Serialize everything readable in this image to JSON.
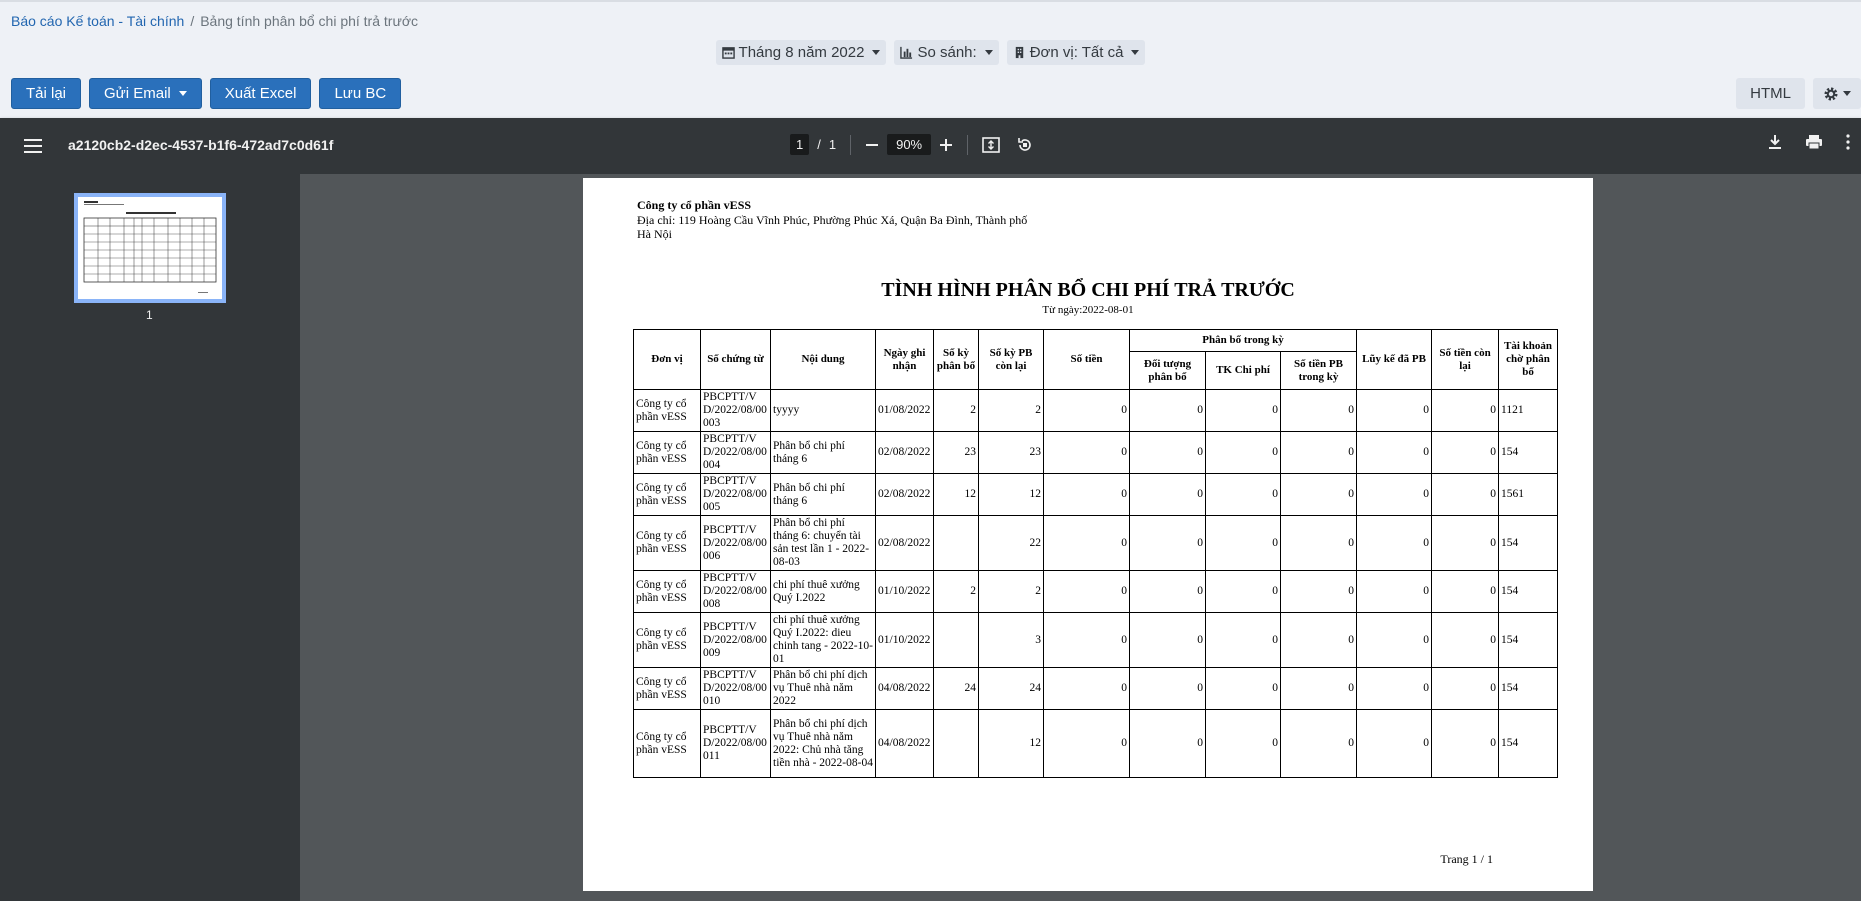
{
  "breadcrumb": {
    "root": "Báo cáo Kế toán - Tài chính",
    "current": "Bảng tính phân bổ chi phí trả trước"
  },
  "filters": {
    "period": "Tháng 8 năm 2022",
    "compare": "So sánh:",
    "unit": "Đơn vị: Tất cả"
  },
  "actions": {
    "reload": "Tải lại",
    "email": "Gửi Email",
    "excel": "Xuất Excel",
    "save": "Lưu BC",
    "html": "HTML"
  },
  "viewer": {
    "filename": "a2120cb2-d2ec-4537-b1f6-472ad7c0d61f",
    "page_current": "1",
    "page_sep": "/",
    "page_total": "1",
    "zoom": "90%",
    "thumb_label": "1"
  },
  "report": {
    "company": "Công ty cổ phần vESS",
    "address": "Địa chỉ: 119 Hoàng Cầu Vĩnh Phúc, Phường Phúc Xá, Quận Ba Đình, Thành phố Hà Nội",
    "title": "TÌNH HÌNH PHÂN BỔ CHI PHÍ TRẢ TRƯỚC",
    "date": "Từ ngày:2022-08-01",
    "footer": "Trang 1 /  1",
    "headers": {
      "unit": "Đơn vị",
      "voucher": "Số chứng từ",
      "content": "Nội dung",
      "date": "Ngày ghi nhận",
      "periods": "Số kỳ phân bổ",
      "remaining_periods": "Số kỳ PB còn lại",
      "amount": "Số tiền",
      "group": "Phân bổ trong kỳ",
      "object": "Đối tượng phân bổ",
      "expense_acc": "TK Chi phí",
      "period_amount": "Số tiền PB trong kỳ",
      "cumulative": "Lũy kế đã PB",
      "remaining": "Số tiền còn lại",
      "pending_acc": "Tài khoản chờ phân bổ"
    },
    "rows": [
      {
        "unit": "Công ty cổ phần vESS",
        "voucher": "PBCPTT/VD/2022/08/00003",
        "content": "tyyyy",
        "date": "01/08/2022",
        "periods": "2",
        "remaining_periods": "2",
        "amount": "0",
        "object": "0",
        "expense_acc": "0",
        "period_amount": "0",
        "cumulative": "0",
        "remaining": "0",
        "pending_acc": "1121"
      },
      {
        "unit": "Công ty cổ phần vESS",
        "voucher": "PBCPTT/VD/2022/08/00004",
        "content": "Phân bổ chi phí tháng 6",
        "date": "02/08/2022",
        "periods": "23",
        "remaining_periods": "23",
        "amount": "0",
        "object": "0",
        "expense_acc": "0",
        "period_amount": "0",
        "cumulative": "0",
        "remaining": "0",
        "pending_acc": "154"
      },
      {
        "unit": "Công ty cổ phần vESS",
        "voucher": "PBCPTT/VD/2022/08/00005",
        "content": "Phân bổ chi phí tháng 6",
        "date": "02/08/2022",
        "periods": "12",
        "remaining_periods": "12",
        "amount": "0",
        "object": "0",
        "expense_acc": "0",
        "period_amount": "0",
        "cumulative": "0",
        "remaining": "0",
        "pending_acc": "1561"
      },
      {
        "unit": "Công ty cổ phần vESS",
        "voucher": "PBCPTT/VD/2022/08/00006",
        "content": "Phân bổ chi phí tháng 6: chuyển tài sản test lần 1 - 2022-08-03",
        "date": "02/08/2022",
        "periods": "",
        "remaining_periods": "22",
        "amount": "0",
        "object": "0",
        "expense_acc": "0",
        "period_amount": "0",
        "cumulative": "0",
        "remaining": "0",
        "pending_acc": "154"
      },
      {
        "unit": "Công ty cổ phần vESS",
        "voucher": "PBCPTT/VD/2022/08/00008",
        "content": "chi phí thuê xưởng Quý I.2022",
        "date": "01/10/2022",
        "periods": "2",
        "remaining_periods": "2",
        "amount": "0",
        "object": "0",
        "expense_acc": "0",
        "period_amount": "0",
        "cumulative": "0",
        "remaining": "0",
        "pending_acc": "154"
      },
      {
        "unit": "Công ty cổ phần vESS",
        "voucher": "PBCPTT/VD/2022/08/00009",
        "content": "chi phí thuê xưởng Quý I.2022: dieu chinh tang - 2022-10-01",
        "date": "01/10/2022",
        "periods": "",
        "remaining_periods": "3",
        "amount": "0",
        "object": "0",
        "expense_acc": "0",
        "period_amount": "0",
        "cumulative": "0",
        "remaining": "0",
        "pending_acc": "154"
      },
      {
        "unit": "Công ty cổ phần vESS",
        "voucher": "PBCPTT/VD/2022/08/00010",
        "content": "Phân bổ chi phí dịch vụ Thuê nhà năm 2022",
        "date": "04/08/2022",
        "periods": "24",
        "remaining_periods": "24",
        "amount": "0",
        "object": "0",
        "expense_acc": "0",
        "period_amount": "0",
        "cumulative": "0",
        "remaining": "0",
        "pending_acc": "154"
      },
      {
        "unit": "Công ty cổ phần vESS",
        "voucher": "PBCPTT/VD/2022/08/00011",
        "content": "Phân bổ chi phí dịch vụ Thuê nhà năm 2022: Chủ nhà tăng tiền nhà - 2022-08-04",
        "date": "04/08/2022",
        "periods": "",
        "remaining_periods": "12",
        "amount": "0",
        "object": "0",
        "expense_acc": "0",
        "period_amount": "0",
        "cumulative": "0",
        "remaining": "0",
        "pending_acc": "154"
      }
    ]
  }
}
